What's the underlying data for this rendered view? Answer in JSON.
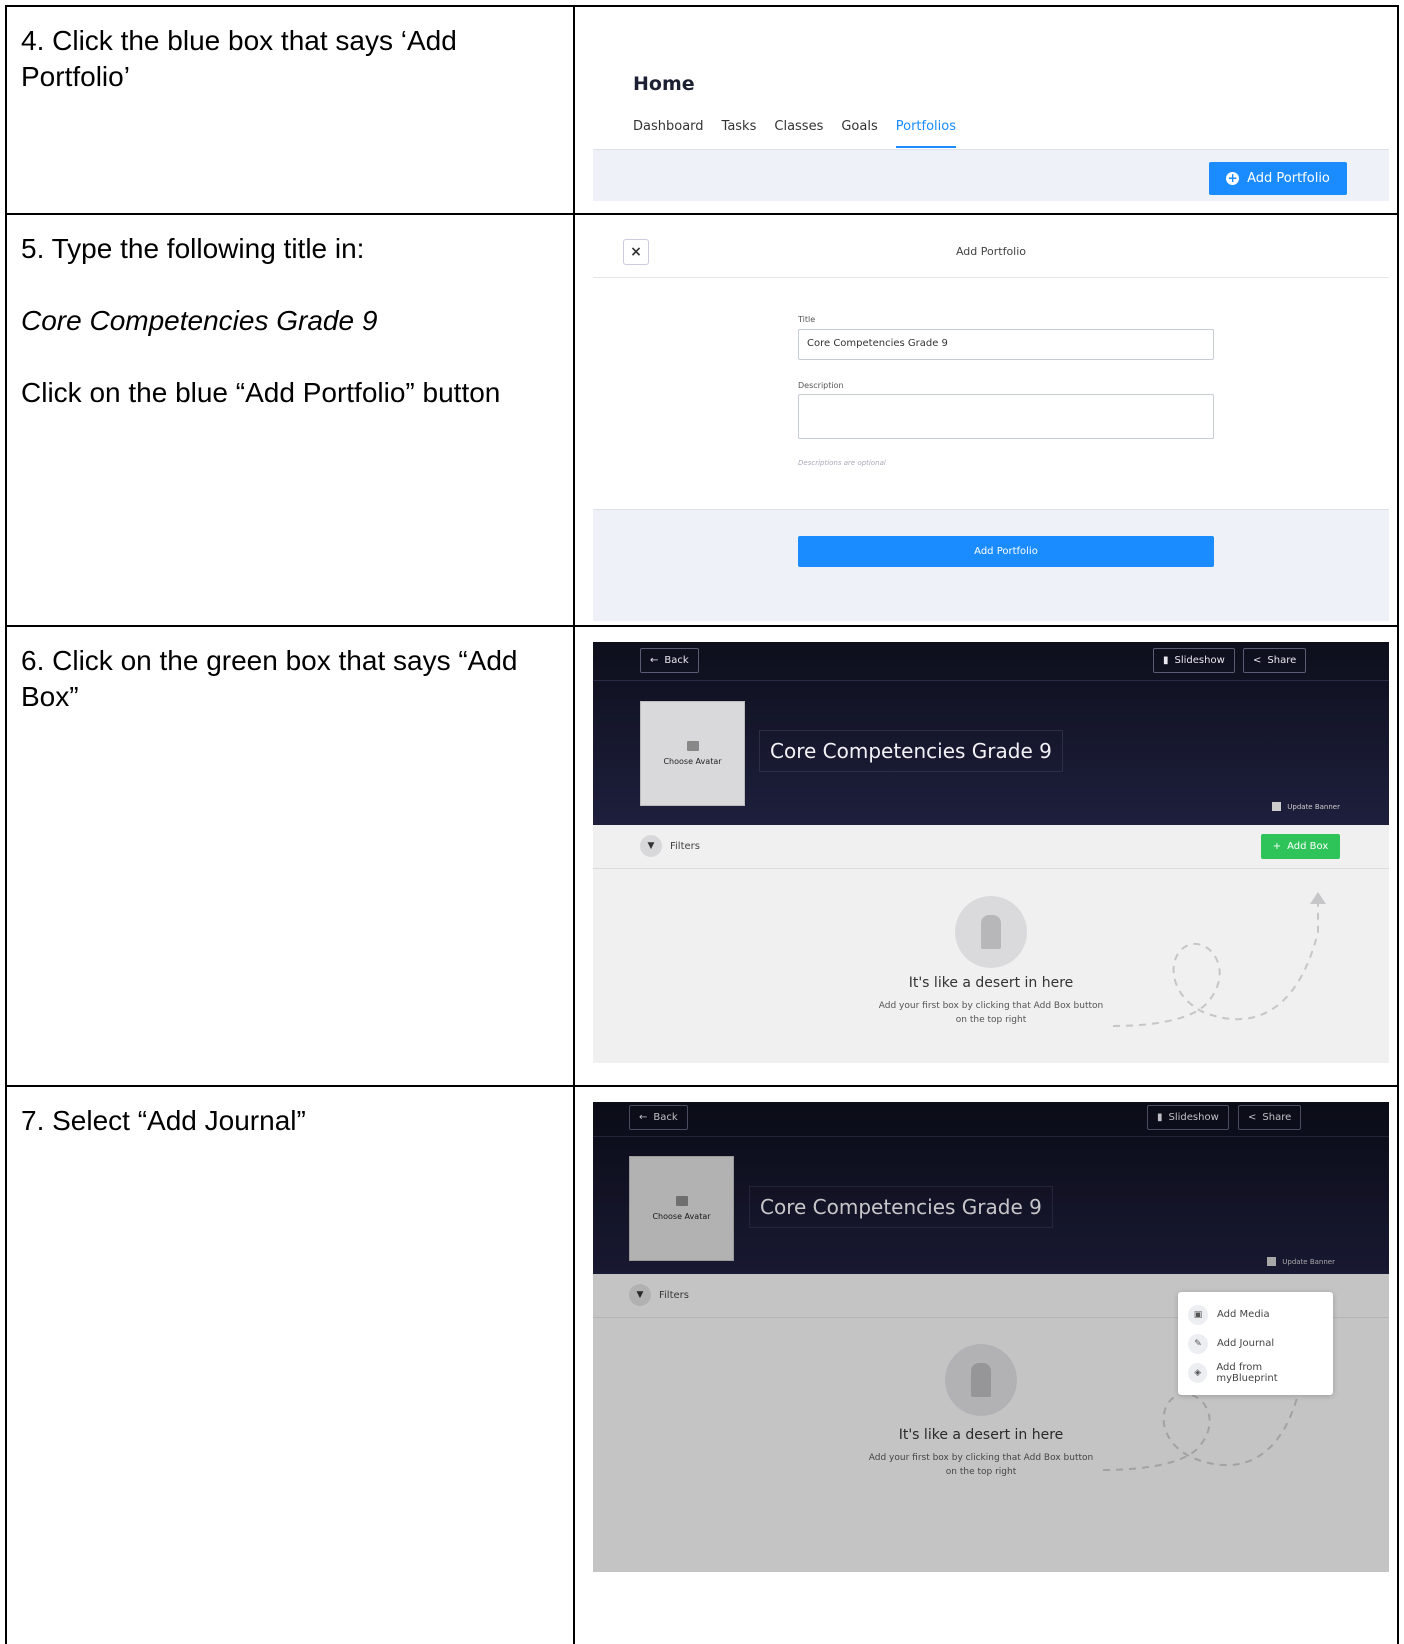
{
  "steps": {
    "s4": {
      "text": "4. Click the blue box that says ‘Add Portfolio’"
    },
    "s5": {
      "line1": "5. Type the following title in:",
      "line2": "Core Competencies Grade 9",
      "line3": "Click on the blue “Add Portfolio” button"
    },
    "s6": {
      "text": "6. Click on the green box that says “Add Box”"
    },
    "s7": {
      "text": "7. Select “Add Journal”"
    }
  },
  "home": {
    "title": "Home",
    "tabs": [
      "Dashboard",
      "Tasks",
      "Classes",
      "Goals",
      "Portfolios"
    ],
    "active_tab": "Portfolios",
    "add_button": "Add Portfolio"
  },
  "modal": {
    "title": "Add Portfolio",
    "close_glyph": "×",
    "title_label": "Title",
    "title_value": "Core Competencies Grade 9",
    "description_label": "Description",
    "description_hint": "Descriptions are optional",
    "submit": "Add Portfolio"
  },
  "portfolio": {
    "back": "Back",
    "slideshow": "Slideshow",
    "share": "Share",
    "choose_avatar": "Choose Avatar",
    "title": "Core Competencies Grade 9",
    "update_banner": "Update Banner",
    "filters": "Filters",
    "add_box": "Add Box",
    "empty_title": "It's like a desert in here",
    "empty_sub1": "Add your first box by clicking that Add Box button",
    "empty_sub2": "on the top right"
  },
  "menu": {
    "items": [
      "Add Media",
      "Add Journal",
      "Add from myBlueprint"
    ]
  },
  "colors": {
    "primary_blue": "#1a8cff",
    "add_box_green": "#2ec45a",
    "header_dark": "#12142a"
  }
}
